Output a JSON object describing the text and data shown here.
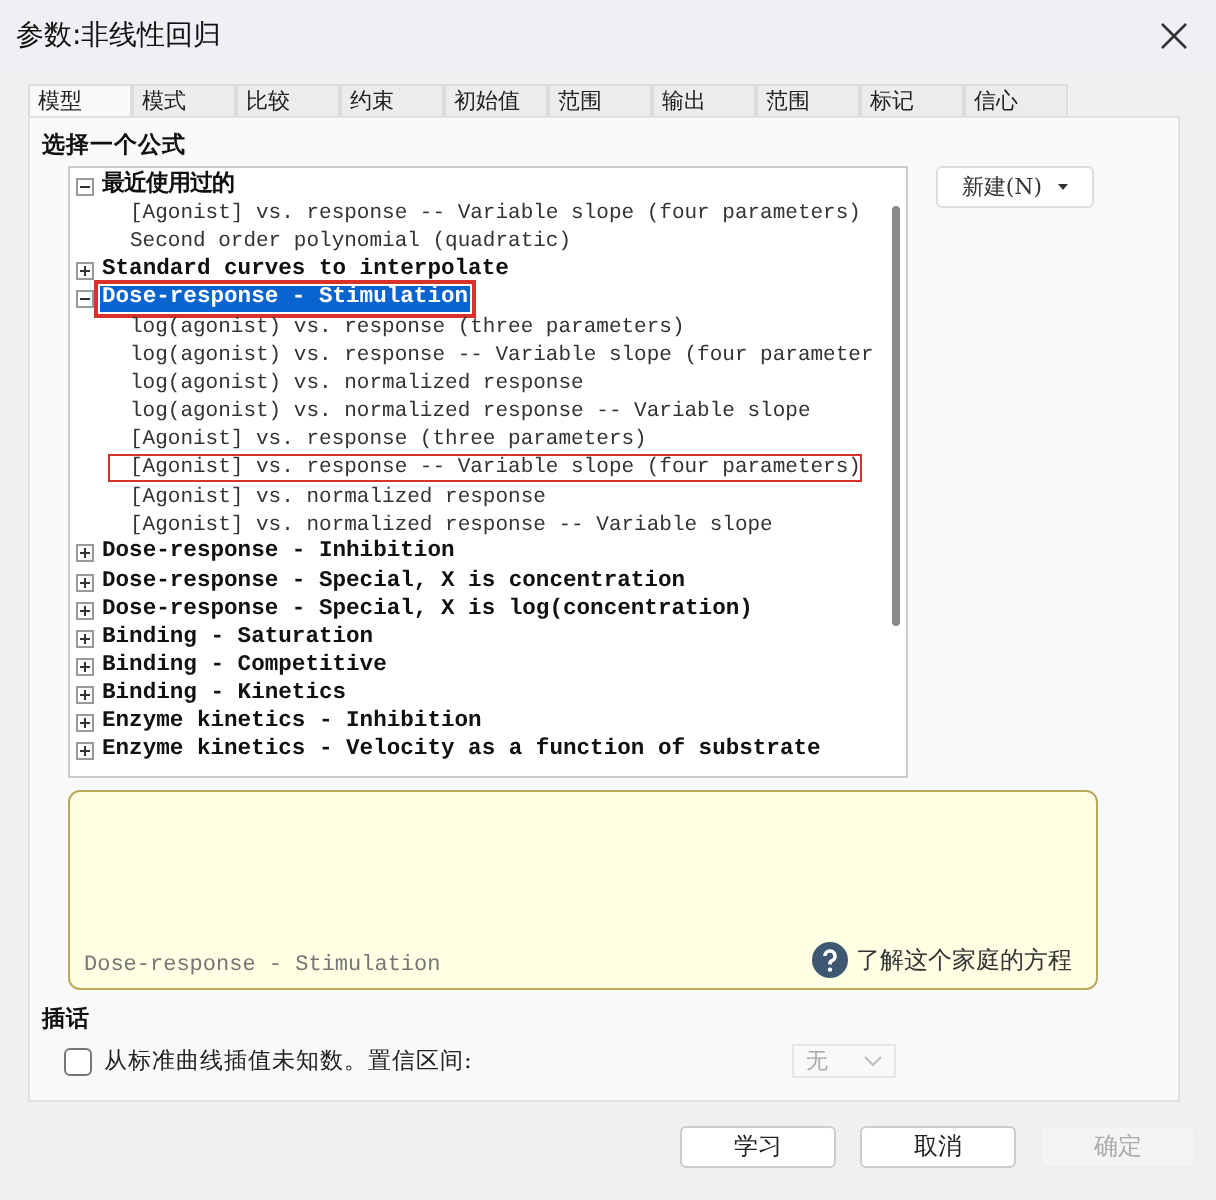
{
  "window": {
    "title": "参数:非线性回归"
  },
  "tabs": [
    {
      "label": "模型",
      "selected": true
    },
    {
      "label": "模式",
      "selected": false
    },
    {
      "label": "比较",
      "selected": false
    },
    {
      "label": "约束",
      "selected": false
    },
    {
      "label": "初始值",
      "selected": false
    },
    {
      "label": "范围",
      "selected": false
    },
    {
      "label": "输出",
      "selected": false
    },
    {
      "label": "范围",
      "selected": false
    },
    {
      "label": "标记",
      "selected": false
    },
    {
      "label": "信心",
      "selected": false
    }
  ],
  "section_title": "选择一个公式",
  "tree": [
    {
      "label": "最近使用过的",
      "expanded": true,
      "selected": false,
      "outlined": false,
      "children": [
        {
          "label": "[Agonist] vs. response -- Variable slope (four parameters)",
          "outlined": false
        },
        {
          "label": "Second order polynomial (quadratic)",
          "outlined": false
        }
      ]
    },
    {
      "label": "Standard curves to interpolate",
      "expanded": false,
      "selected": false,
      "outlined": false
    },
    {
      "label": "Dose-response - Stimulation",
      "expanded": true,
      "selected": true,
      "outlined": true,
      "children": [
        {
          "label": "log(agonist) vs. response (three parameters)",
          "outlined": false
        },
        {
          "label": "log(agonist) vs. response -- Variable slope (four parameter",
          "outlined": false
        },
        {
          "label": "log(agonist) vs. normalized response",
          "outlined": false
        },
        {
          "label": "log(agonist) vs. normalized response -- Variable slope",
          "outlined": false
        },
        {
          "label": "[Agonist] vs. response (three parameters)",
          "outlined": false
        },
        {
          "label": "[Agonist] vs. response -- Variable slope (four parameters)",
          "outlined": true
        },
        {
          "label": "[Agonist] vs. normalized response",
          "outlined": false
        },
        {
          "label": "[Agonist] vs. normalized response -- Variable slope",
          "outlined": false
        }
      ]
    },
    {
      "label": "Dose-response - Inhibition",
      "expanded": false,
      "selected": false,
      "outlined": false
    },
    {
      "label": "Dose-response - Special, X is concentration",
      "expanded": false,
      "selected": false,
      "outlined": false
    },
    {
      "label": "Dose-response - Special, X is log(concentration)",
      "expanded": false,
      "selected": false,
      "outlined": false
    },
    {
      "label": "Binding - Saturation",
      "expanded": false,
      "selected": false,
      "outlined": false
    },
    {
      "label": "Binding - Competitive",
      "expanded": false,
      "selected": false,
      "outlined": false
    },
    {
      "label": "Binding - Kinetics",
      "expanded": false,
      "selected": false,
      "outlined": false
    },
    {
      "label": "Enzyme kinetics - Inhibition",
      "expanded": false,
      "selected": false,
      "outlined": false
    },
    {
      "label": "Enzyme kinetics - Velocity as a function of substrate",
      "expanded": false,
      "selected": false,
      "outlined": false
    }
  ],
  "new_button": {
    "label": "新建(N)"
  },
  "description": {
    "family": "Dose-response - Stimulation",
    "help_link": "了解这个家庭的方程"
  },
  "interpolate": {
    "title": "插话",
    "checkbox_label": "从标准曲线插值未知数。置信区间:",
    "checked": false,
    "dropdown": {
      "value": "无",
      "disabled": true
    }
  },
  "buttons": [
    {
      "label": "学习",
      "disabled": false
    },
    {
      "label": "取消",
      "disabled": false
    },
    {
      "label": "确定",
      "disabled": true
    }
  ]
}
